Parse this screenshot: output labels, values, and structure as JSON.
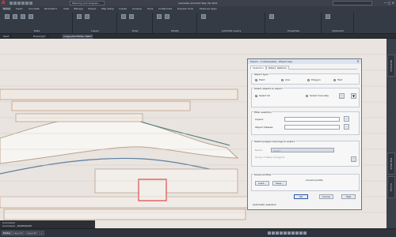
{
  "app": {
    "window_title": "Autodesk AutoCAD Map 3D 2021",
    "doc_dropdown": "Planning and Analysis...",
    "ribbon_tabs": [
      "Home",
      "Insert",
      "Annotate",
      "Parametric",
      "View",
      "Manage",
      "Output",
      "Map Setup",
      "Create",
      "Analyze",
      "Tools",
      "Collaborate",
      "Express Tools",
      "Featured Apps"
    ],
    "ribbon_panels": [
      "Data",
      "Layers",
      "Draw",
      "Modify",
      "AutoCAD Layers",
      "Properties",
      "Clipboard"
    ],
    "file_tabs": [
      "Start",
      "Drawing1*",
      "CalgaryNorthPlan.DWG*"
    ],
    "right_sidebar_tabs": [
      "Task Pane",
      "Map Book",
      "Survey"
    ],
    "command_lines": [
      "Command:",
      "Command: _MAPEXPORT"
    ]
  },
  "status": {
    "layout_tabs": [
      "Model",
      "Layout1",
      "Layout2",
      "+"
    ]
  },
  "dialog": {
    "title": "Export - C:\\Users\\Ada\\...\\Export.shp",
    "close": "×",
    "tabs": [
      "Selection",
      "Data",
      "Options"
    ],
    "object_type": {
      "title": "Object type",
      "options": [
        "Point",
        "Line",
        "Polygon",
        "Text"
      ],
      "selected": "Point"
    },
    "select_objects": {
      "title": "Select objects to export",
      "select_all": "Select all",
      "select_manually": "Select manually"
    },
    "filter": {
      "title": "Filter selection",
      "layers_label": "Layers:",
      "classes_label": "Object Classes:"
    },
    "polygon": {
      "title": "Select polygon topology to export",
      "name_label": "Name:",
      "group_label": "Group complex polygons",
      "name_value": "Select"
    },
    "profile": {
      "title": "Saved profiles",
      "current_label": "Current profile",
      "load": "Load...",
      "save": "Save..."
    },
    "footer": {
      "ok": "OK",
      "cancel": "Cancel",
      "help": "Help",
      "auto_select": "Automatic selection"
    }
  }
}
